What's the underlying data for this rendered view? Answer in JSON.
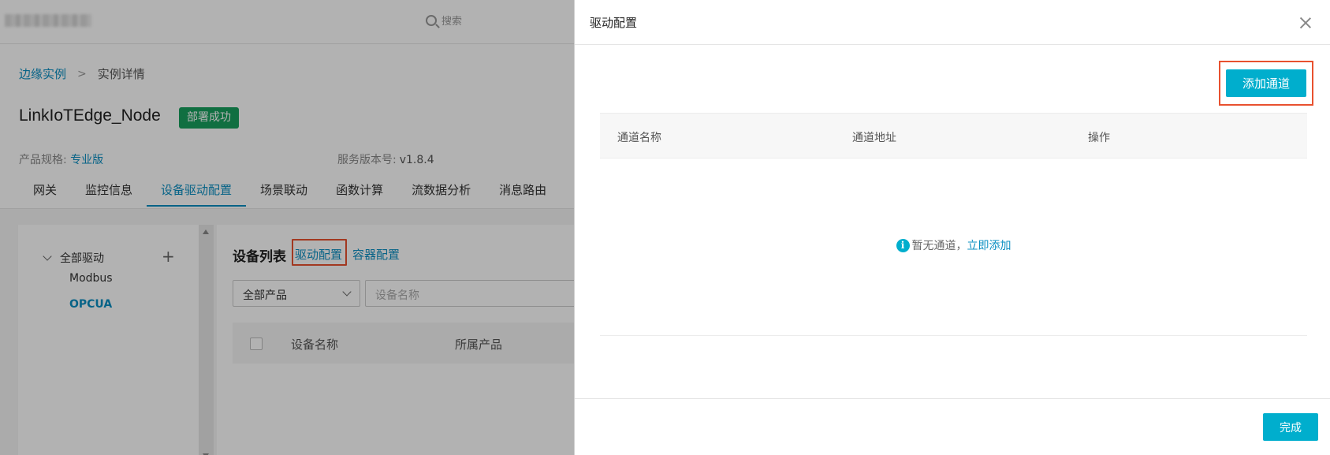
{
  "topbar": {
    "search_label": "搜索"
  },
  "breadcrumb": {
    "root": "边缘实例",
    "separator": ">",
    "current": "实例详情"
  },
  "instance": {
    "name": "LinkIoTEdge_Node",
    "status": "部署成功",
    "spec_label": "产品规格:",
    "spec_value": "专业版",
    "version_label": "服务版本号:",
    "version_value": "v1.8.4"
  },
  "tabs": [
    "网关",
    "监控信息",
    "设备驱动配置",
    "场景联动",
    "函数计算",
    "流数据分析",
    "消息路由"
  ],
  "tree": {
    "root_label": "全部驱动",
    "add_symbol": "+",
    "items": [
      "Modbus",
      "OPCUA"
    ]
  },
  "device_list": {
    "title": "设备列表",
    "driver_config_link": "驱动配置",
    "container_config_link": "容器配置",
    "product_select_value": "全部产品",
    "name_placeholder": "设备名称",
    "columns": [
      "设备名称",
      "所属产品"
    ]
  },
  "drawer": {
    "title": "驱动配置",
    "add_channel_label": "添加通道",
    "columns": [
      "通道名称",
      "通道地址",
      "操作"
    ],
    "empty_text": "暂无通道，",
    "empty_link": "立即添加",
    "info_symbol": "i",
    "done_label": "完成"
  },
  "colors": {
    "accent": "#00aecd",
    "link": "#0b8fc2",
    "success": "#17a05d",
    "highlight": "#e8512f"
  }
}
